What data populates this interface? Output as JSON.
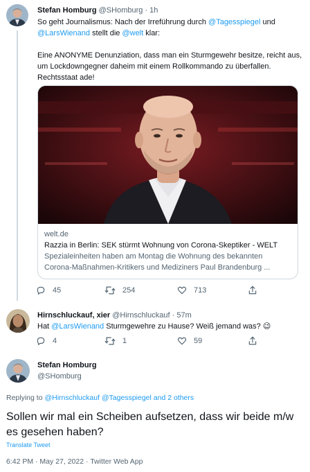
{
  "tweet1": {
    "name": "Stefan Homburg",
    "handle": "@SHomburg",
    "sep": "·",
    "time": "1h",
    "text_p1_a": "So geht Journalismus: Nach der Irreführung durch ",
    "mention1": "@Tagesspiegel",
    "text_p1_b": " und",
    "mention2": "@LarsWienand",
    "text_p1_c": " stellt die ",
    "mention3": "@welt",
    "text_p1_d": " klar:",
    "text_p2": "Eine ANONYME Denunziation, dass man ein Sturmgewehr besitze, reicht aus, um Lockdowngegner daheim mit einem Rollkommando zu überfallen. Rechtsstaat ade!",
    "card": {
      "domain": "welt.de",
      "title": "Razzia in Berlin: SEK stürmt Wohnung von Corona-Skeptiker - WELT",
      "desc_line1": "Spezialeinheiten haben am Montag die Wohnung des bekannten",
      "desc_line2": "Corona-Maßnahmen-Kritikers und Mediziners Paul Brandenburg ..."
    },
    "replies": "45",
    "retweets": "254",
    "likes": "713"
  },
  "tweet2": {
    "name": "Hirnschluckauf, xier",
    "handle": "@Hirnschluckauf",
    "sep": "·",
    "time": "57m",
    "text_a": "Hat ",
    "mention": "@LarsWienand",
    "text_b": " Sturmgewehre zu Hause? Weiß jemand was? 😉",
    "replies": "4",
    "retweets": "1",
    "likes": "59"
  },
  "tweet3": {
    "name": "Stefan Homburg",
    "handle": "@SHomburg",
    "replying_prefix": "Replying to ",
    "replying_to": "@Hirnschluckauf @Tagesspiegel and 2 others",
    "text": "Sollen wir mal ein Scheiben aufsetzen, dass wir beide m/w es gesehen haben?",
    "translate": "Translate Tweet",
    "timestamp": "6:42 PM · May 27, 2022 · Twitter Web App"
  },
  "icons": {
    "reply": "reply-icon",
    "retweet": "retweet-icon",
    "like": "heart-icon",
    "share": "share-icon"
  },
  "colors": {
    "link": "#1d9bf0",
    "muted": "#536471",
    "text": "#0f1419"
  }
}
